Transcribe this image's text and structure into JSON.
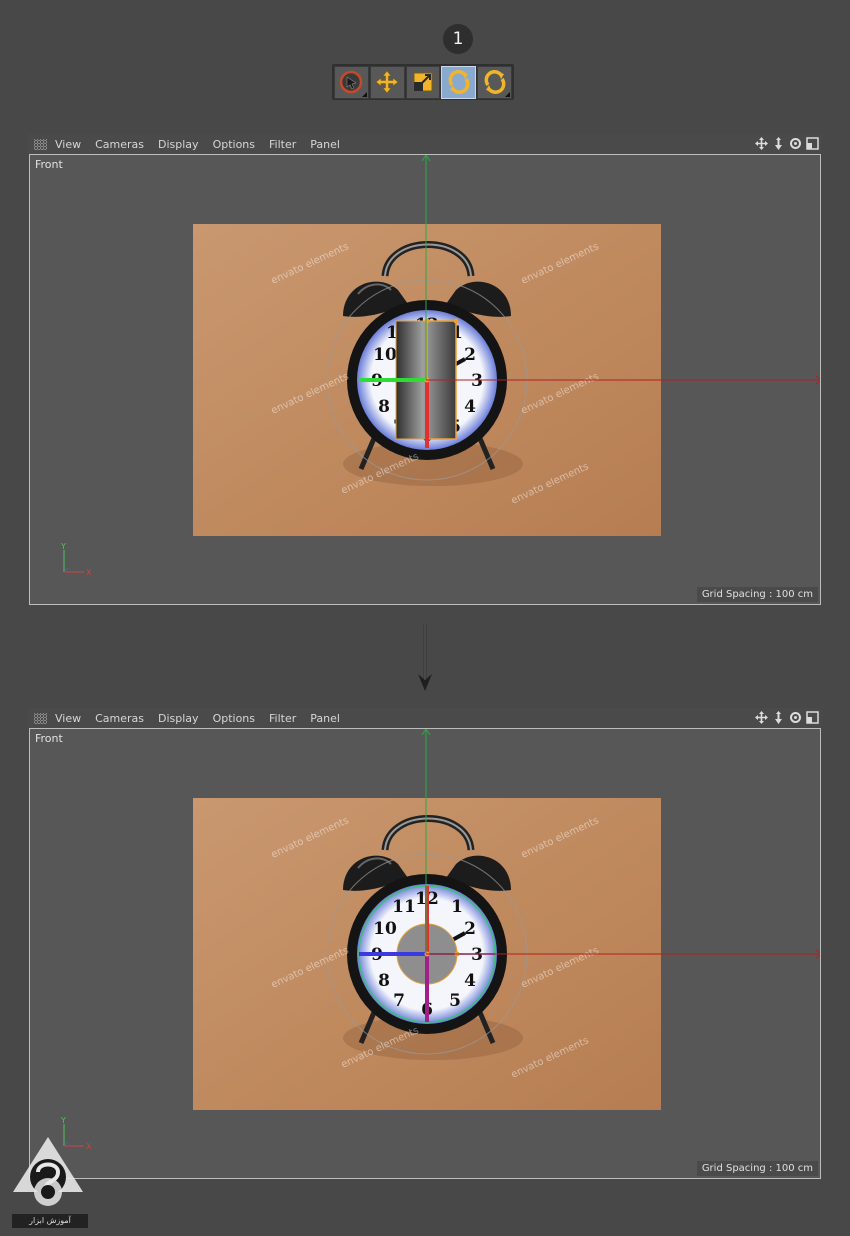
{
  "step": {
    "number": "1"
  },
  "toolbar": {
    "tools": [
      {
        "name": "select-tool",
        "icon": "cursor-icon"
      },
      {
        "name": "move-tool",
        "icon": "move-arrows-icon"
      },
      {
        "name": "scale-tool",
        "icon": "scale-icon"
      },
      {
        "name": "rotate-tool",
        "icon": "rotate-icon",
        "active": true
      },
      {
        "name": "rotate-alt-tool",
        "icon": "rotate-icon"
      }
    ],
    "active_color": "#8aa9cf",
    "icon_color": "#f1b52c"
  },
  "viewports": [
    {
      "menu": [
        "View",
        "Cameras",
        "Display",
        "Options",
        "Filter",
        "Panel"
      ],
      "camera_label": "Front",
      "grid_spacing": "Grid Spacing : 100 cm",
      "axis_x": "X",
      "axis_y": "Y",
      "object": "cylinder-side"
    },
    {
      "menu": [
        "View",
        "Cameras",
        "Display",
        "Options",
        "Filter",
        "Panel"
      ],
      "camera_label": "Front",
      "grid_spacing": "Grid Spacing : 100 cm",
      "axis_x": "X",
      "axis_y": "Y",
      "object": "cylinder-front"
    }
  ],
  "watermark": "envato elements",
  "clock_numbers": [
    "12",
    "1",
    "2",
    "3",
    "4",
    "5",
    "6",
    "7",
    "8",
    "9",
    "10",
    "11"
  ],
  "logo_text": "آموزش ابزار"
}
